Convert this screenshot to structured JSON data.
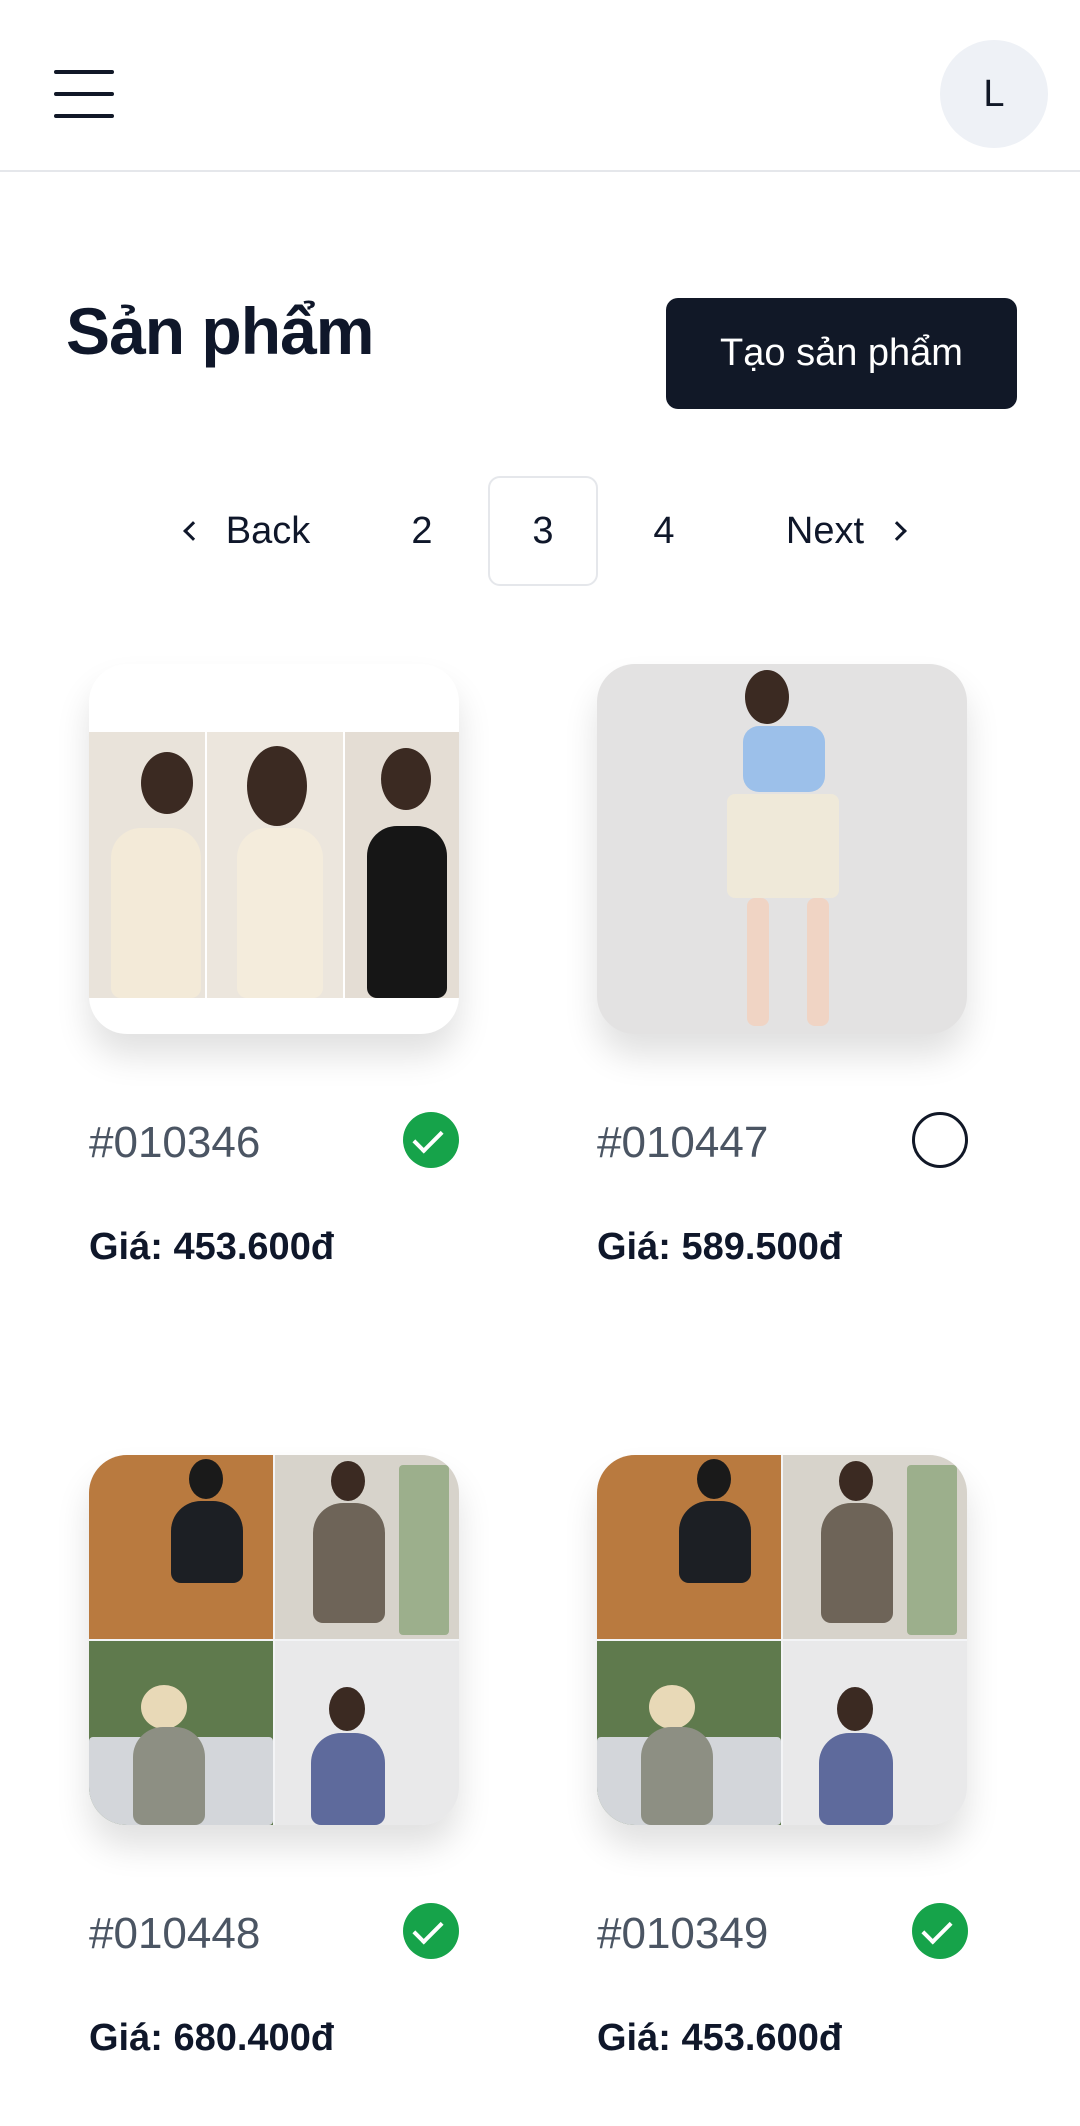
{
  "header": {
    "avatar_initial": "L"
  },
  "page": {
    "title": "Sản phẩm",
    "create_button": "Tạo sản phẩm"
  },
  "pagination": {
    "back": "Back",
    "pages": [
      "2",
      "3",
      "4"
    ],
    "current": "3",
    "next": "Next"
  },
  "products": [
    {
      "code": "#010346",
      "price": "Giá: 453.600đ",
      "active": true
    },
    {
      "code": "#010447",
      "price": "Giá: 589.500đ",
      "active": false
    },
    {
      "code": "#010448",
      "price": "Giá: 680.400đ",
      "active": true
    },
    {
      "code": "#010349",
      "price": "Giá: 453.600đ",
      "active": true
    }
  ],
  "colors": {
    "primary": "#111827",
    "active_status": "#16a34a",
    "border": "#e5e7eb"
  }
}
